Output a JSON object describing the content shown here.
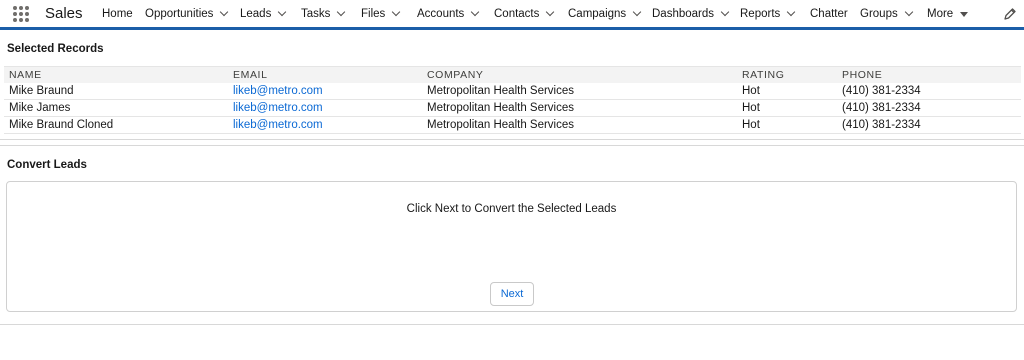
{
  "app": {
    "name": "Sales"
  },
  "nav": {
    "items": [
      {
        "label": "Home",
        "dropdown": false
      },
      {
        "label": "Opportunities",
        "dropdown": true
      },
      {
        "label": "Leads",
        "dropdown": true
      },
      {
        "label": "Tasks",
        "dropdown": true
      },
      {
        "label": "Files",
        "dropdown": true
      },
      {
        "label": "Accounts",
        "dropdown": true
      },
      {
        "label": "Contacts",
        "dropdown": true
      },
      {
        "label": "Campaigns",
        "dropdown": true
      },
      {
        "label": "Dashboards",
        "dropdown": true
      },
      {
        "label": "Reports",
        "dropdown": true
      },
      {
        "label": "Chatter",
        "dropdown": false
      },
      {
        "label": "Groups",
        "dropdown": true
      },
      {
        "label": "More",
        "dropdown": true
      }
    ]
  },
  "selected_records": {
    "title": "Selected Records",
    "columns": [
      "NAME",
      "EMAIL",
      "COMPANY",
      "RATING",
      "PHONE"
    ],
    "rows": [
      {
        "name": "Mike Braund",
        "email": "likeb@metro.com",
        "company": "Metropolitan Health Services",
        "rating": "Hot",
        "phone": "(410) 381-2334"
      },
      {
        "name": "Mike James",
        "email": "likeb@metro.com",
        "company": "Metropolitan Health Services",
        "rating": "Hot",
        "phone": "(410) 381-2334"
      },
      {
        "name": "Mike Braund Cloned",
        "email": "likeb@metro.com",
        "company": "Metropolitan Health Services",
        "rating": "Hot",
        "phone": "(410) 381-2334"
      }
    ]
  },
  "convert": {
    "title": "Convert Leads",
    "message": "Click Next to Convert the Selected Leads",
    "next_label": "Next"
  },
  "colors": {
    "accent": "#1b5ea8",
    "link": "#0b69d4"
  }
}
